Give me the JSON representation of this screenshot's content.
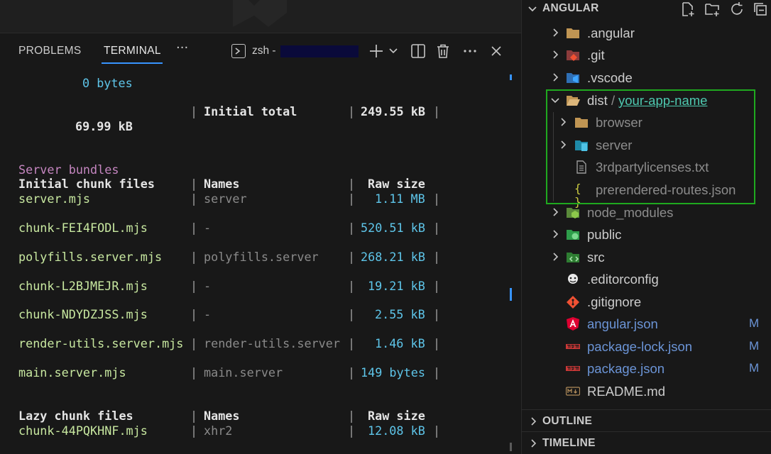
{
  "panel": {
    "tabs": [
      "PROBLEMS",
      "TERMINAL"
    ],
    "active_tab": "TERMINAL",
    "more": "···",
    "terminal_name": "zsh -"
  },
  "terminal": {
    "bytes_line": "0 bytes",
    "initial_total_label": "Initial total",
    "initial_total_value": "249.55 kB",
    "wrapped_value": "69.99 kB",
    "server_bundles": "Server bundles",
    "initial_header": [
      "Initial chunk files",
      "Names",
      "Raw size"
    ],
    "initial_rows": [
      {
        "file": "server.mjs",
        "name": "server",
        "size": "1.11 MB"
      },
      {
        "file": "chunk-FEI4FODL.mjs",
        "name": "-",
        "size": "520.51 kB"
      },
      {
        "file": "polyfills.server.mjs",
        "name": "polyfills.server",
        "size": "268.21 kB"
      },
      {
        "file": "chunk-L2BJMEJR.mjs",
        "name": "-",
        "size": "19.21 kB"
      },
      {
        "file": "chunk-NDYDZJSS.mjs",
        "name": "-",
        "size": "2.55 kB"
      },
      {
        "file": "render-utils.server.mjs",
        "name": "render-utils.server",
        "size": "1.46 kB"
      },
      {
        "file": "main.server.mjs",
        "name": "main.server",
        "size": "149 bytes"
      }
    ],
    "lazy_header": [
      "Lazy chunk files",
      "Names",
      "Raw size"
    ],
    "lazy_rows": [
      {
        "file": "chunk-44PQKHNF.mjs",
        "name": "xhr2",
        "size": "12.08 kB"
      }
    ]
  },
  "explorer": {
    "title": "ANGULAR",
    "items": [
      {
        "label": ".angular",
        "icon": "folder-icon",
        "kind": "folder"
      },
      {
        "label": ".git",
        "icon": "git-folder-icon",
        "kind": "folder"
      },
      {
        "label": ".vscode",
        "icon": "vscode-folder-icon",
        "kind": "folder"
      },
      {
        "label": "dist",
        "path_sep": "/",
        "path_child": "your-app-name",
        "icon": "open-folder-icon",
        "kind": "open-folder"
      },
      {
        "label": "browser",
        "icon": "folder-icon",
        "kind": "folder",
        "depth": 1
      },
      {
        "label": "server",
        "icon": "server-folder-icon",
        "kind": "folder",
        "depth": 1
      },
      {
        "label": "3rdpartylicenses.txt",
        "icon": "text-file-icon",
        "kind": "file",
        "depth": 1
      },
      {
        "label": "prerendered-routes.json",
        "icon": "json-file-icon",
        "kind": "file",
        "depth": 1
      },
      {
        "label": "node_modules",
        "icon": "node-folder-icon",
        "kind": "folder"
      },
      {
        "label": "public",
        "icon": "public-folder-icon",
        "kind": "folder"
      },
      {
        "label": "src",
        "icon": "src-folder-icon",
        "kind": "folder"
      },
      {
        "label": ".editorconfig",
        "icon": "editorconfig-icon",
        "kind": "file"
      },
      {
        "label": ".gitignore",
        "icon": "git-file-icon",
        "kind": "file"
      },
      {
        "label": "angular.json",
        "icon": "angular-icon",
        "kind": "file",
        "badge": "M"
      },
      {
        "label": "package-lock.json",
        "icon": "npm-icon",
        "kind": "file",
        "badge": "M"
      },
      {
        "label": "package.json",
        "icon": "npm-icon",
        "kind": "file",
        "badge": "M"
      },
      {
        "label": "README.md",
        "icon": "markdown-icon",
        "kind": "file"
      }
    ],
    "sections": [
      "OUTLINE",
      "TIMELINE"
    ]
  },
  "colors": {
    "accent": "#3794ff",
    "highlight_box": "#1fa91f",
    "terminal_green": "#c8e8a0",
    "terminal_cyan": "#5ec5e9",
    "terminal_purple": "#c586c0",
    "modified": "#6b94d6"
  }
}
